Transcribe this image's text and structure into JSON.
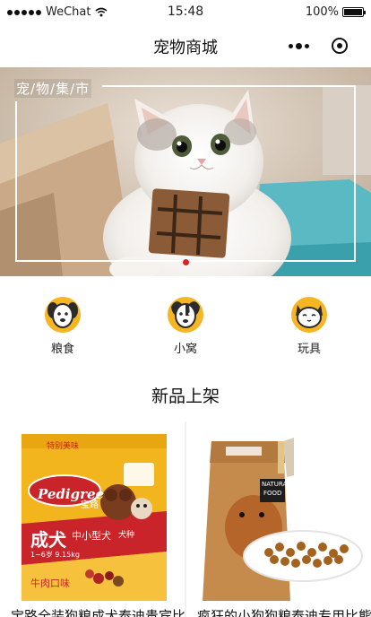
{
  "status_bar": {
    "carrier": "WeChat",
    "time": "15:48",
    "battery_percent": "100%",
    "battery_level": 1.0
  },
  "nav": {
    "title": "宠物商城",
    "more_icon": "more-dots-icon",
    "close_icon": "close-circle-icon"
  },
  "banner": {
    "label": "宠/物/集/市",
    "indicator_color": "#d9232b"
  },
  "categories": [
    {
      "label": "粮食",
      "icon": "dog-icon"
    },
    {
      "label": "小窝",
      "icon": "puppy-icon"
    },
    {
      "label": "玩具",
      "icon": "cat-icon"
    }
  ],
  "section": {
    "title": "新品上架"
  },
  "products": [
    {
      "title": "宝路全装狗粮成犬泰迪贵宾比",
      "brand": "Pedigree",
      "brand_sub": "宝路",
      "badge": "特别美味",
      "name_big": "成犬",
      "name_small": "中小型犬",
      "name_tag": "犬种",
      "age": "1~6岁 9.15kg",
      "flavor": "牛肉口味"
    },
    {
      "title": "疯狂的小狗狗粮泰迪专用比熊",
      "tag_line1": "NATURAL",
      "tag_line2": "FOOD"
    }
  ],
  "colors": {
    "accent_yellow": "#f6b623",
    "pedigree_yellow": "#f2b51d",
    "pedigree_red": "#c8242a"
  }
}
